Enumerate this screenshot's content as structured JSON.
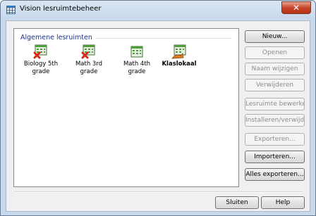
{
  "window": {
    "title": "Vision lesruimtebeheer",
    "close_label": "✕",
    "title_icon": "grid-icon"
  },
  "group": {
    "title": "Algemene lesruimten"
  },
  "items": [
    {
      "label_line1": "Biology 5th",
      "label_line2": "grade",
      "icon": "classroom-error-icon",
      "bold": false
    },
    {
      "label_line1": "Math 3rd",
      "label_line2": "grade",
      "icon": "classroom-error-icon",
      "bold": false
    },
    {
      "label_line1": "Math 4th",
      "label_line2": "grade",
      "icon": "classroom-icon",
      "bold": false
    },
    {
      "label_line1": "Klaslokaal",
      "label_line2": "",
      "icon": "classroom-shared-icon",
      "bold": true
    }
  ],
  "buttons": {
    "nieuw": "Nieuw...",
    "openen": "Openen",
    "naam_wijzigen": "Naam wijzigen",
    "verwijderen": "Verwijderen",
    "lesruimte_bewerken": "Lesruimte bewerken",
    "installeren": "Installeren/verwijderen...",
    "exporteren": "Exporteren...",
    "importeren": "Importeren...",
    "alles_exporteren": "Alles exporteren...",
    "sluiten": "Sluiten",
    "help": "Help"
  },
  "colors": {
    "group_title": "#1e3287",
    "close_button": "#c7452a",
    "error_mark": "#d42a1a",
    "grid_green": "#4f9d3b"
  }
}
